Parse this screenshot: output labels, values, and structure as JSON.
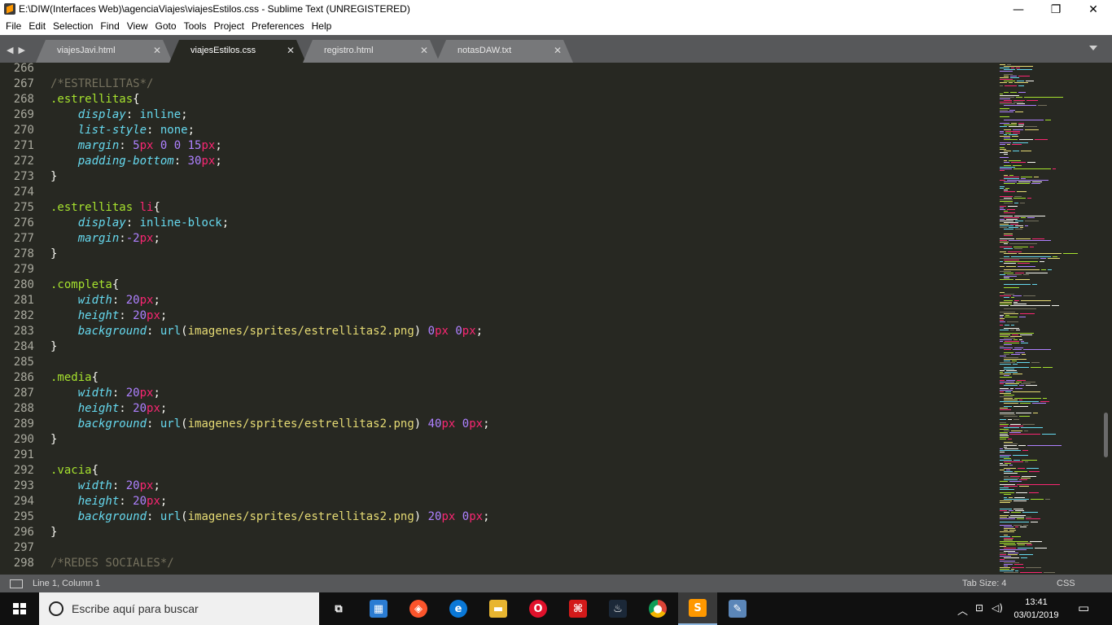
{
  "window": {
    "title": "E:\\DIW(Interfaces Web)\\agenciaViajes\\viajesEstilos.css - Sublime Text (UNREGISTERED)",
    "minimize": "—",
    "maximize": "❐",
    "close": "✕"
  },
  "menu": [
    {
      "u": "F",
      "rest": "ile"
    },
    {
      "u": "E",
      "rest": "dit"
    },
    {
      "u": "S",
      "rest": "election"
    },
    {
      "u": "F",
      "rest": "ind",
      "alt": true
    },
    {
      "u": "V",
      "rest": "iew"
    },
    {
      "u": "G",
      "rest": "oto"
    },
    {
      "u": "T",
      "rest": "ools"
    },
    {
      "u": "P",
      "rest": "roject"
    },
    {
      "u": "",
      "rest": "Preferences",
      "n": true
    },
    {
      "u": "H",
      "rest": "elp"
    }
  ],
  "menu_labels": [
    "File",
    "Edit",
    "Selection",
    "Find",
    "View",
    "Goto",
    "Tools",
    "Project",
    "Preferences",
    "Help"
  ],
  "tabs": [
    {
      "label": "viajesJavi.html",
      "close": "✕",
      "active": false
    },
    {
      "label": "viajesEstilos.css",
      "close": "✕",
      "active": true
    },
    {
      "label": "registro.html",
      "close": "✕",
      "active": false
    },
    {
      "label": "notasDAW.txt",
      "close": "✕",
      "active": false
    }
  ],
  "tab_nav": "◀▶",
  "editor": {
    "lines": [
      {
        "n": "266",
        "t": []
      },
      {
        "n": "267",
        "t": [
          [
            "cmt",
            "/*ESTRELLITAS*/"
          ]
        ]
      },
      {
        "n": "268",
        "t": [
          [
            "sel",
            ".estrellitas"
          ],
          [
            "",
            "{"
          ]
        ]
      },
      {
        "n": "269",
        "t": [
          [
            "",
            "    "
          ],
          [
            "prop",
            "display"
          ],
          [
            "",
            ": "
          ],
          [
            "val",
            "inline"
          ],
          [
            "",
            ";"
          ]
        ]
      },
      {
        "n": "270",
        "t": [
          [
            "",
            "    "
          ],
          [
            "prop",
            "list-style"
          ],
          [
            "",
            ": "
          ],
          [
            "val",
            "none"
          ],
          [
            "",
            ";"
          ]
        ]
      },
      {
        "n": "271",
        "t": [
          [
            "",
            "    "
          ],
          [
            "prop",
            "margin"
          ],
          [
            "",
            ": "
          ],
          [
            "num",
            "5"
          ],
          [
            "unit",
            "px"
          ],
          [
            "",
            ""
          ],
          [
            "num",
            " 0 0 15"
          ],
          [
            "unit",
            "px"
          ],
          [
            "",
            ";"
          ]
        ]
      },
      {
        "n": "272",
        "t": [
          [
            "",
            "    "
          ],
          [
            "prop",
            "padding-bottom"
          ],
          [
            "",
            ": "
          ],
          [
            "num",
            "30"
          ],
          [
            "unit",
            "px"
          ],
          [
            "",
            ";"
          ]
        ]
      },
      {
        "n": "273",
        "t": [
          [
            "",
            "}"
          ]
        ]
      },
      {
        "n": "274",
        "t": []
      },
      {
        "n": "275",
        "t": [
          [
            "sel",
            ".estrellitas "
          ],
          [
            "tag",
            "li"
          ],
          [
            "",
            "{"
          ]
        ]
      },
      {
        "n": "276",
        "t": [
          [
            "",
            "    "
          ],
          [
            "prop",
            "display"
          ],
          [
            "",
            ": "
          ],
          [
            "val",
            "inline-block"
          ],
          [
            "",
            ";"
          ]
        ]
      },
      {
        "n": "277",
        "t": [
          [
            "",
            "    "
          ],
          [
            "prop",
            "margin"
          ],
          [
            "",
            ":"
          ],
          [
            "num",
            "-2"
          ],
          [
            "unit",
            "px"
          ],
          [
            "",
            ";"
          ]
        ]
      },
      {
        "n": "278",
        "t": [
          [
            "",
            "}"
          ]
        ]
      },
      {
        "n": "279",
        "t": []
      },
      {
        "n": "280",
        "t": [
          [
            "sel",
            ".completa"
          ],
          [
            "",
            "{"
          ]
        ]
      },
      {
        "n": "281",
        "t": [
          [
            "",
            "    "
          ],
          [
            "prop",
            "width"
          ],
          [
            "",
            ": "
          ],
          [
            "num",
            "20"
          ],
          [
            "unit",
            "px"
          ],
          [
            "",
            ";"
          ]
        ]
      },
      {
        "n": "282",
        "t": [
          [
            "",
            "    "
          ],
          [
            "prop",
            "height"
          ],
          [
            "",
            ": "
          ],
          [
            "num",
            "20"
          ],
          [
            "unit",
            "px"
          ],
          [
            "",
            ";"
          ]
        ]
      },
      {
        "n": "283",
        "t": [
          [
            "",
            "    "
          ],
          [
            "prop",
            "background"
          ],
          [
            "",
            ": "
          ],
          [
            "fn",
            "url"
          ],
          [
            "",
            "("
          ],
          [
            "str",
            "imagenes/sprites/estrellitas2.png"
          ],
          [
            "",
            ") "
          ],
          [
            "num",
            "0"
          ],
          [
            "unit",
            "px"
          ],
          [
            "num",
            " 0"
          ],
          [
            "unit",
            "px"
          ],
          [
            "",
            ";"
          ]
        ]
      },
      {
        "n": "284",
        "t": [
          [
            "",
            "}"
          ]
        ]
      },
      {
        "n": "285",
        "t": []
      },
      {
        "n": "286",
        "t": [
          [
            "sel",
            ".media"
          ],
          [
            "",
            "{"
          ]
        ]
      },
      {
        "n": "287",
        "t": [
          [
            "",
            "    "
          ],
          [
            "prop",
            "width"
          ],
          [
            "",
            ": "
          ],
          [
            "num",
            "20"
          ],
          [
            "unit",
            "px"
          ],
          [
            "",
            ";"
          ]
        ]
      },
      {
        "n": "288",
        "t": [
          [
            "",
            "    "
          ],
          [
            "prop",
            "height"
          ],
          [
            "",
            ": "
          ],
          [
            "num",
            "20"
          ],
          [
            "unit",
            "px"
          ],
          [
            "",
            ";"
          ]
        ]
      },
      {
        "n": "289",
        "t": [
          [
            "",
            "    "
          ],
          [
            "prop",
            "background"
          ],
          [
            "",
            ": "
          ],
          [
            "fn",
            "url"
          ],
          [
            "",
            "("
          ],
          [
            "str",
            "imagenes/sprites/estrellitas2.png"
          ],
          [
            "",
            ") "
          ],
          [
            "num",
            "40"
          ],
          [
            "unit",
            "px"
          ],
          [
            "num",
            " 0"
          ],
          [
            "unit",
            "px"
          ],
          [
            "",
            ";"
          ]
        ]
      },
      {
        "n": "290",
        "t": [
          [
            "",
            "}"
          ]
        ]
      },
      {
        "n": "291",
        "t": []
      },
      {
        "n": "292",
        "t": [
          [
            "sel",
            ".vacia"
          ],
          [
            "",
            "{"
          ]
        ]
      },
      {
        "n": "293",
        "t": [
          [
            "",
            "    "
          ],
          [
            "prop",
            "width"
          ],
          [
            "",
            ": "
          ],
          [
            "num",
            "20"
          ],
          [
            "unit",
            "px"
          ],
          [
            "",
            ";"
          ]
        ]
      },
      {
        "n": "294",
        "t": [
          [
            "",
            "    "
          ],
          [
            "prop",
            "height"
          ],
          [
            "",
            ": "
          ],
          [
            "num",
            "20"
          ],
          [
            "unit",
            "px"
          ],
          [
            "",
            ";"
          ]
        ]
      },
      {
        "n": "295",
        "t": [
          [
            "",
            "    "
          ],
          [
            "prop",
            "background"
          ],
          [
            "",
            ": "
          ],
          [
            "fn",
            "url"
          ],
          [
            "",
            "("
          ],
          [
            "str",
            "imagenes/sprites/estrellitas2.png"
          ],
          [
            "",
            ") "
          ],
          [
            "num",
            "20"
          ],
          [
            "unit",
            "px"
          ],
          [
            "num",
            " 0"
          ],
          [
            "unit",
            "px"
          ],
          [
            "",
            ";"
          ]
        ]
      },
      {
        "n": "296",
        "t": [
          [
            "",
            "}"
          ]
        ]
      },
      {
        "n": "297",
        "t": []
      },
      {
        "n": "298",
        "t": [
          [
            "cmt",
            "/*REDES SOCIALES*/"
          ]
        ]
      }
    ]
  },
  "status": {
    "position": "Line 1, Column 1",
    "tab_size": "Tab Size: 4",
    "syntax": "CSS"
  },
  "taskbar": {
    "search_placeholder": "Escribe aquí para buscar",
    "time": "13:41",
    "date": "03/01/2019",
    "apps": [
      {
        "name": "task-view-icon",
        "glyph": "⧉",
        "color": "#101010"
      },
      {
        "name": "store-icon",
        "glyph": "▦",
        "color": "#2b7cd3"
      },
      {
        "name": "brave-icon",
        "glyph": "◈",
        "color": "#fb542b"
      },
      {
        "name": "edge-icon",
        "glyph": "e",
        "color": "#0a78d7"
      },
      {
        "name": "file-explorer-icon",
        "glyph": "▬",
        "color": "#e8b530"
      },
      {
        "name": "opera-icon",
        "glyph": "O",
        "color": "#e0112b"
      },
      {
        "name": "acrobat-icon",
        "glyph": "⌘",
        "color": "#d31a1a"
      },
      {
        "name": "steam-icon",
        "glyph": "♨",
        "color": "#1b2838"
      },
      {
        "name": "chrome-icon",
        "glyph": "●",
        "color": "#4aa853"
      },
      {
        "name": "sublime-text-icon",
        "glyph": "S",
        "color": "#ff9800",
        "active": true
      },
      {
        "name": "paint-icon",
        "glyph": "✎",
        "color": "#5b86b8"
      }
    ]
  }
}
